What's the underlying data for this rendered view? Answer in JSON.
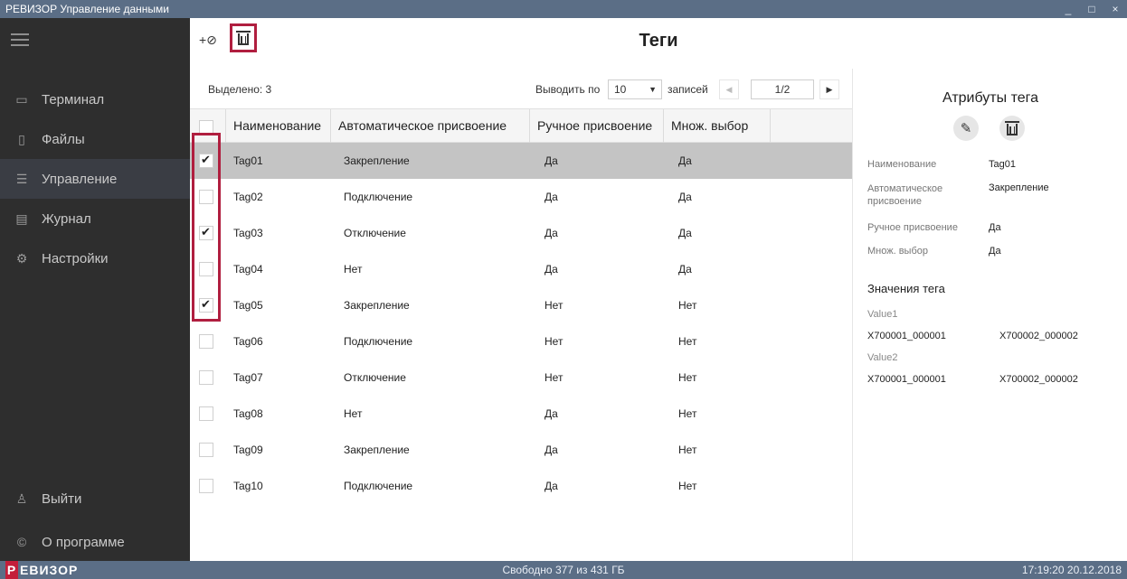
{
  "window": {
    "title": "РЕВИЗОР Управление данными",
    "controls": [
      "_",
      "□",
      "×"
    ]
  },
  "sidebar": {
    "items": [
      {
        "label": "Терминал",
        "icon": "terminal-icon",
        "glyph": "▭"
      },
      {
        "label": "Файлы",
        "icon": "files-icon",
        "glyph": "▯"
      },
      {
        "label": "Управление",
        "icon": "sliders-icon",
        "glyph": "☰",
        "active": true
      },
      {
        "label": "Журнал",
        "icon": "journal-icon",
        "glyph": "▤"
      },
      {
        "label": "Настройки",
        "icon": "gear-icon",
        "glyph": "⚙"
      }
    ],
    "bottom": [
      {
        "label": "Выйти",
        "icon": "user-icon",
        "glyph": "♙"
      },
      {
        "label": "О программе",
        "icon": "copyright-icon",
        "glyph": "©"
      }
    ]
  },
  "header": {
    "title": "Теги",
    "add_glyph": "+⊘"
  },
  "list": {
    "selected_text": "Выделено: 3",
    "pager": {
      "label": "Выводить по",
      "per_page": "10",
      "suffix": "записей",
      "page": "1/2"
    },
    "columns": [
      "Наименование",
      "Автоматическое присвоение",
      "Ручное присвоение",
      "Множ. выбор"
    ],
    "rows": [
      {
        "name": "Tag01",
        "auto": "Закрепление",
        "manual": "Да",
        "multi": "Да",
        "checked": true,
        "selected": true
      },
      {
        "name": "Tag02",
        "auto": "Подключение",
        "manual": "Да",
        "multi": "Да",
        "checked": false,
        "selected": false
      },
      {
        "name": "Tag03",
        "auto": "Отключение",
        "manual": "Да",
        "multi": "Да",
        "checked": true,
        "selected": false
      },
      {
        "name": "Tag04",
        "auto": "Нет",
        "manual": "Да",
        "multi": "Да",
        "checked": false,
        "selected": false
      },
      {
        "name": "Tag05",
        "auto": "Закрепление",
        "manual": "Нет",
        "multi": "Нет",
        "checked": true,
        "selected": false
      },
      {
        "name": "Tag06",
        "auto": "Подключение",
        "manual": "Нет",
        "multi": "Нет",
        "checked": false,
        "selected": false
      },
      {
        "name": "Tag07",
        "auto": "Отключение",
        "manual": "Нет",
        "multi": "Нет",
        "checked": false,
        "selected": false
      },
      {
        "name": "Tag08",
        "auto": "Нет",
        "manual": "Да",
        "multi": "Нет",
        "checked": false,
        "selected": false
      },
      {
        "name": "Tag09",
        "auto": "Закрепление",
        "manual": "Да",
        "multi": "Нет",
        "checked": false,
        "selected": false
      },
      {
        "name": "Tag10",
        "auto": "Подключение",
        "manual": "Да",
        "multi": "Нет",
        "checked": false,
        "selected": false
      }
    ]
  },
  "attributes": {
    "title": "Атрибуты тега",
    "fields": [
      {
        "label": "Наименование",
        "value": "Tag01"
      },
      {
        "label": "Автоматическое присвоение",
        "value": "Закрепление"
      },
      {
        "label": "Ручное присвоение",
        "value": "Да"
      },
      {
        "label": "Множ. выбор",
        "value": "Да"
      }
    ],
    "values_title": "Значения тега",
    "values": [
      {
        "name": "Value1",
        "a": "X700001_000001",
        "b": "X700002_000002"
      },
      {
        "name": "Value2",
        "a": "X700001_000001",
        "b": "X700002_000002"
      }
    ]
  },
  "status": {
    "logo_letter": "Р",
    "logo_rest": "ЕВИЗОР",
    "free": "Свободно 377 из 431 ГБ",
    "clock": "17:19:20 20.12.2018"
  },
  "colors": {
    "titlebar": "#5b6e86",
    "sidebar": "#2e2e2e",
    "highlight": "#b01e3f",
    "selected_row": "#c4c4c4"
  }
}
